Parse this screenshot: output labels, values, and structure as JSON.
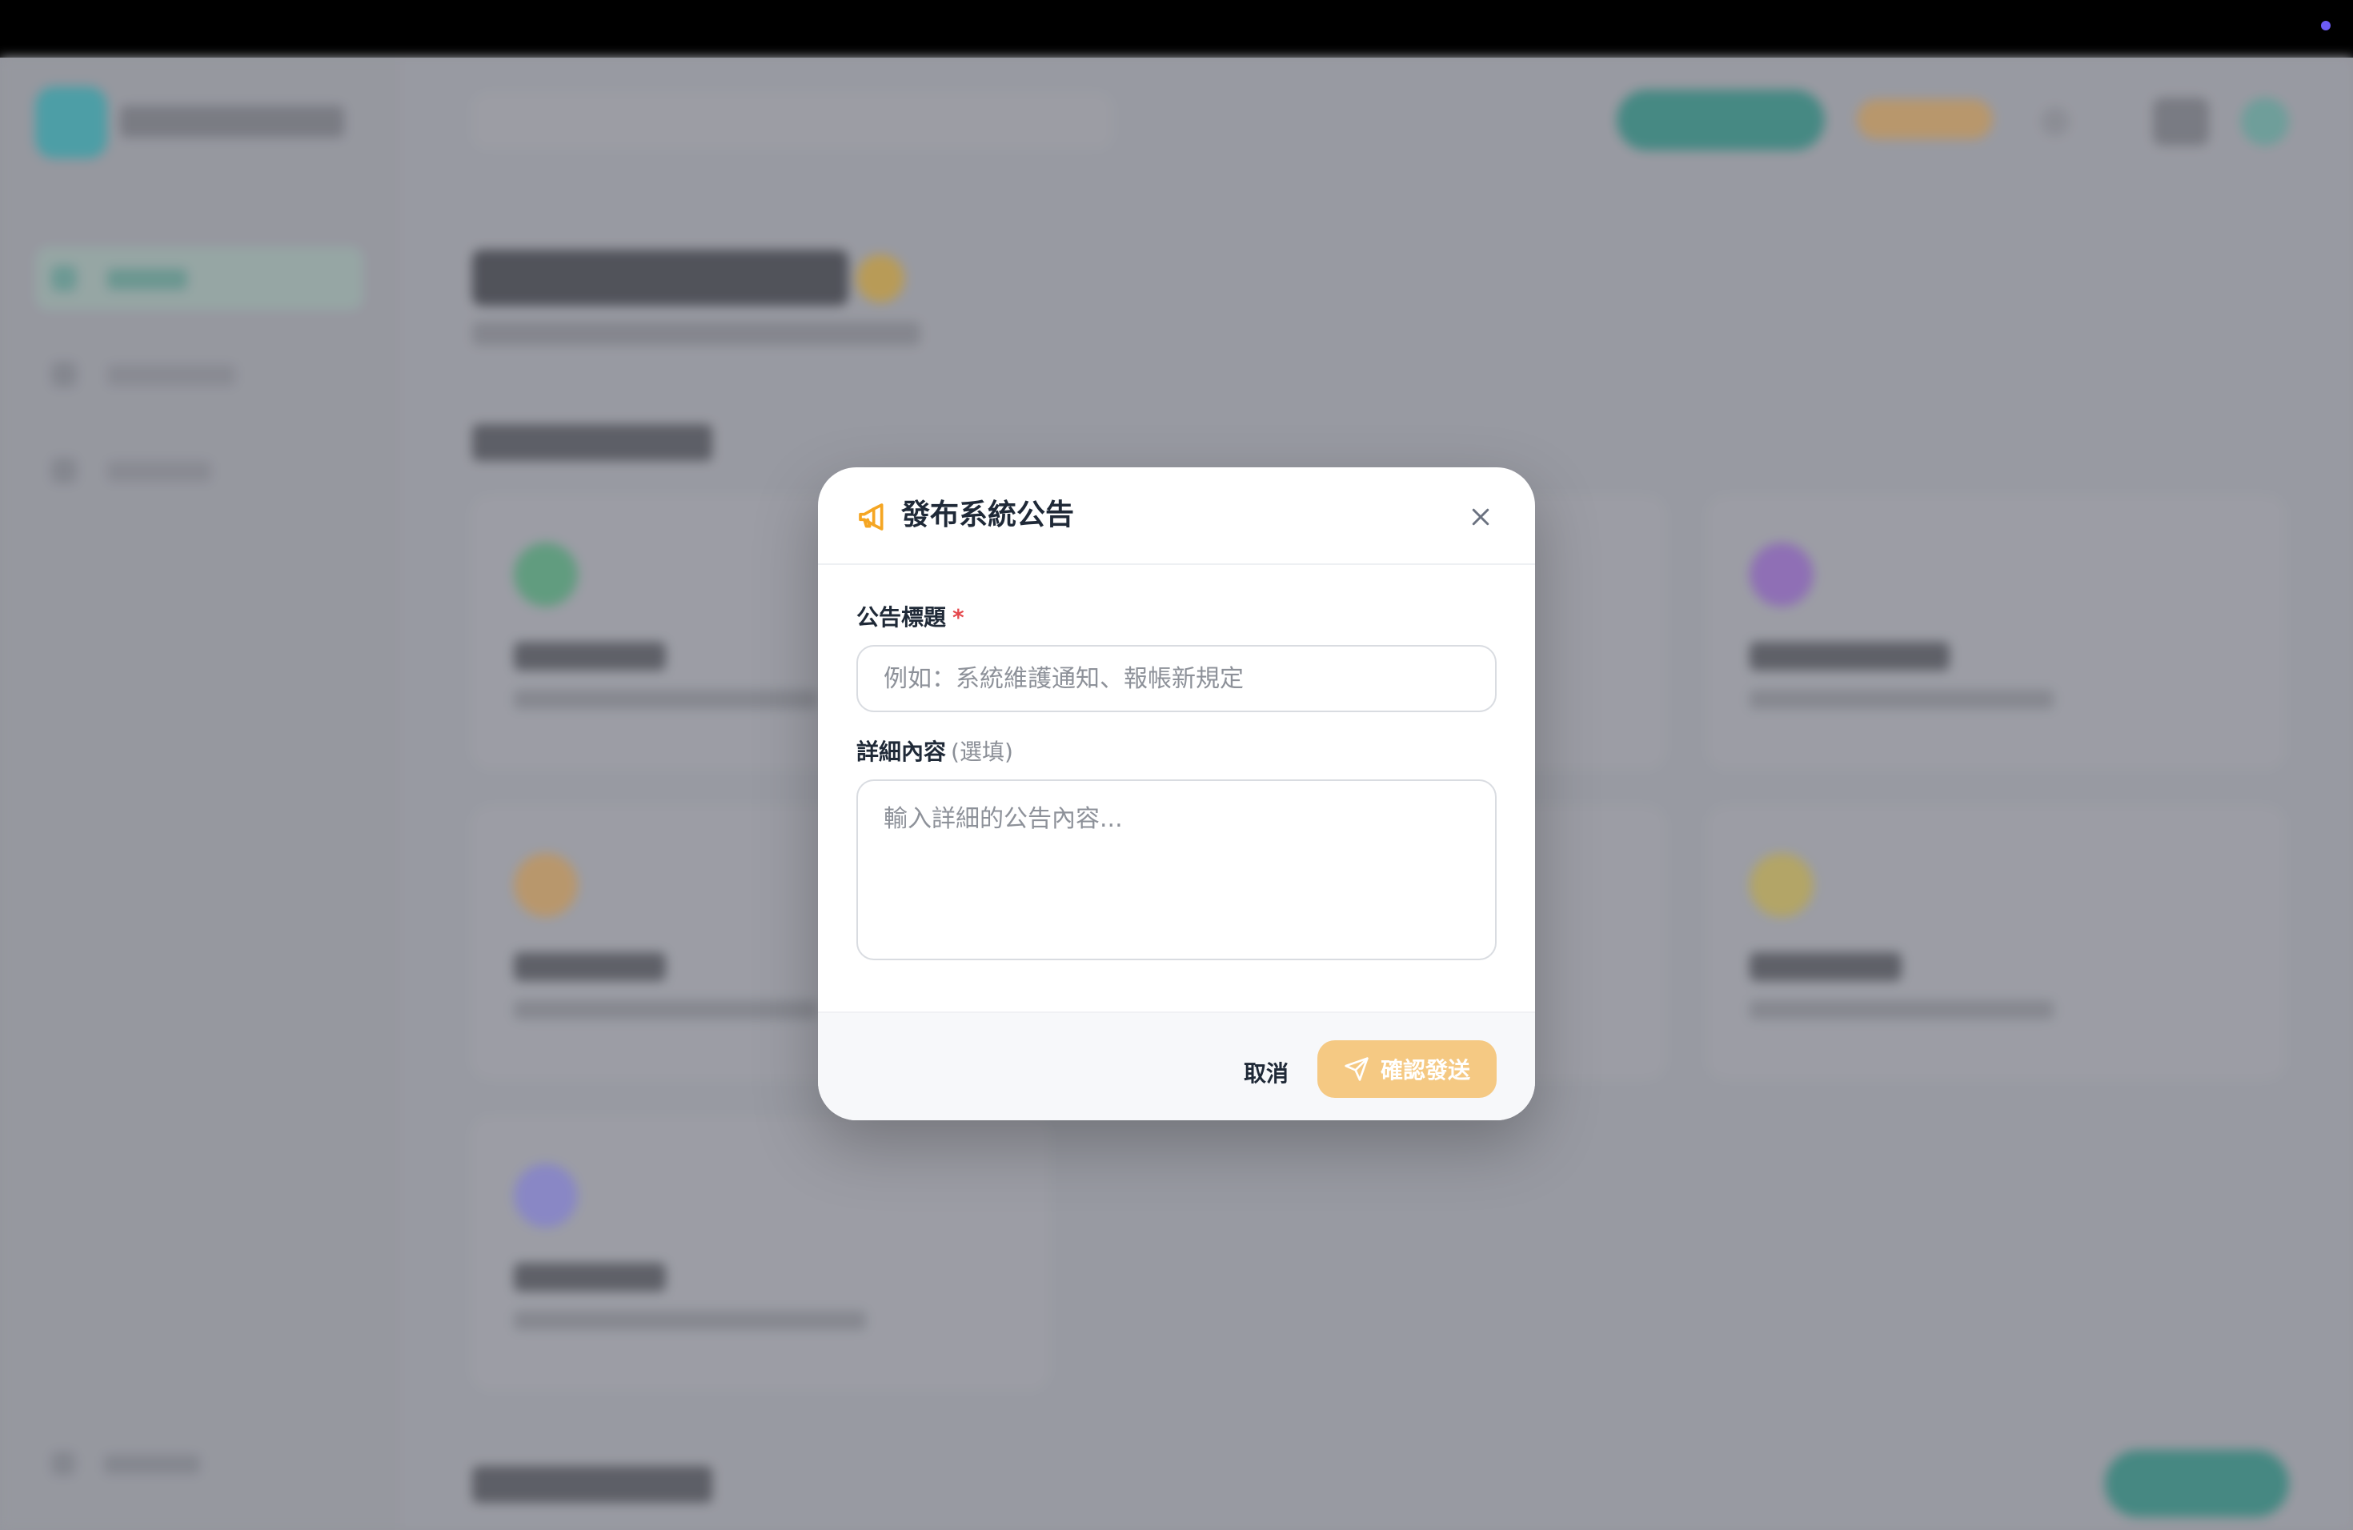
{
  "modal": {
    "title": "發布系統公告",
    "icon": "megaphone-icon",
    "close_icon": "close-icon",
    "accent_color": "#f5a623",
    "fields": {
      "title_label": "公告標題",
      "required_mark": "*",
      "title_placeholder": "例如：系統維護通知、報帳新規定",
      "title_value": "",
      "content_label": "詳細內容",
      "content_optional": "(選填)",
      "content_placeholder": "輸入詳細的公告內容...",
      "content_value": ""
    },
    "footer": {
      "cancel_label": "取消",
      "confirm_label": "確認發送",
      "confirm_icon": "send-icon",
      "confirm_color": "#f5c983"
    }
  }
}
